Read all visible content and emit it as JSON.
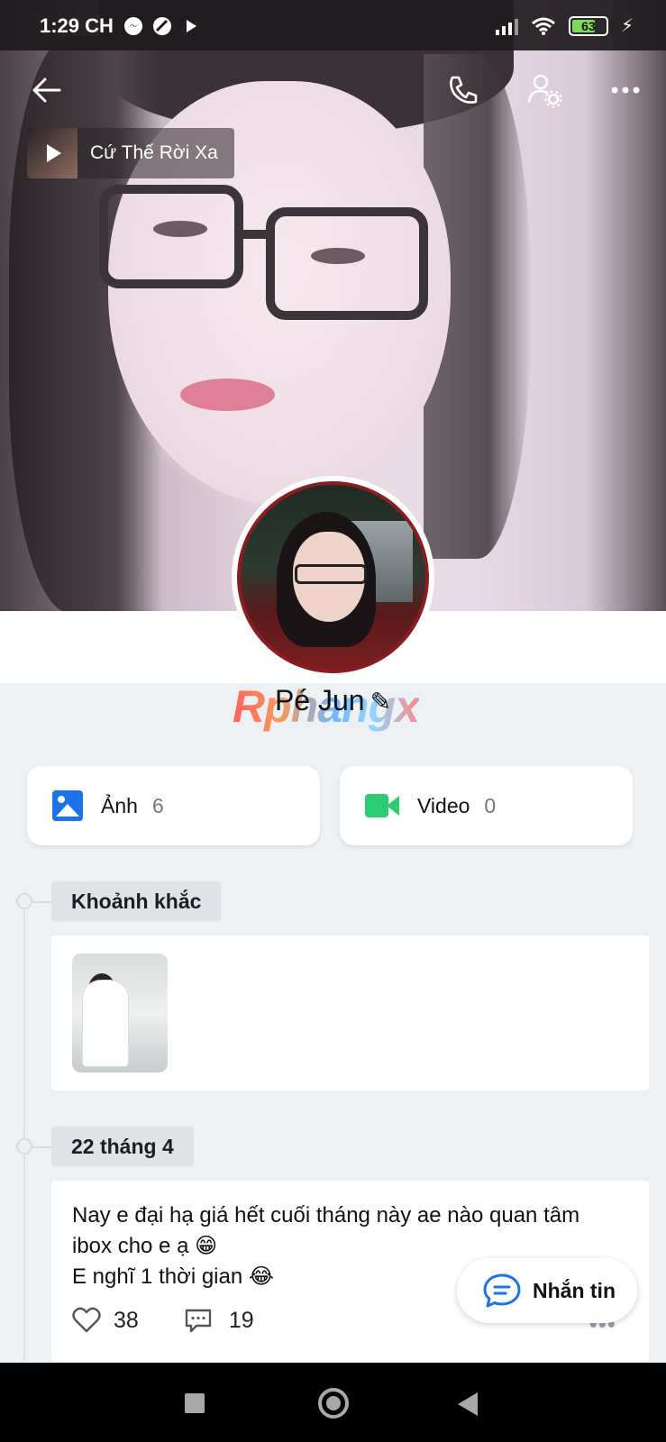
{
  "status_bar": {
    "time": "1:29 CH",
    "battery_level": "63",
    "notification_icons": [
      "messenger-icon",
      "circle-app-icon",
      "play-store-icon"
    ]
  },
  "header": {
    "icons": [
      "back-arrow-icon",
      "phone-icon",
      "profile-settings-icon",
      "more-icon"
    ]
  },
  "music": {
    "title": "Cứ Thế Rời Xa"
  },
  "profile": {
    "name": "Pé Jun",
    "watermark": "Rphangx"
  },
  "media_cards": [
    {
      "label": "Ảnh",
      "count": "6",
      "icon": "photo-icon",
      "color": "#1a73e8"
    },
    {
      "label": "Video",
      "count": "0",
      "icon": "video-icon",
      "color": "#2ecc71"
    }
  ],
  "sections": {
    "moments_label": "Khoảnh khắc",
    "date_label": "22 tháng 4"
  },
  "post": {
    "text": "Nay e đại hạ giá hết cuối tháng này ae nào quan tâm ibox cho e ạ 😁\nE nghĩ 1 thời gian 😂",
    "likes": "38",
    "comments": "19"
  },
  "chat_button": {
    "label": "Nhắn tin"
  }
}
